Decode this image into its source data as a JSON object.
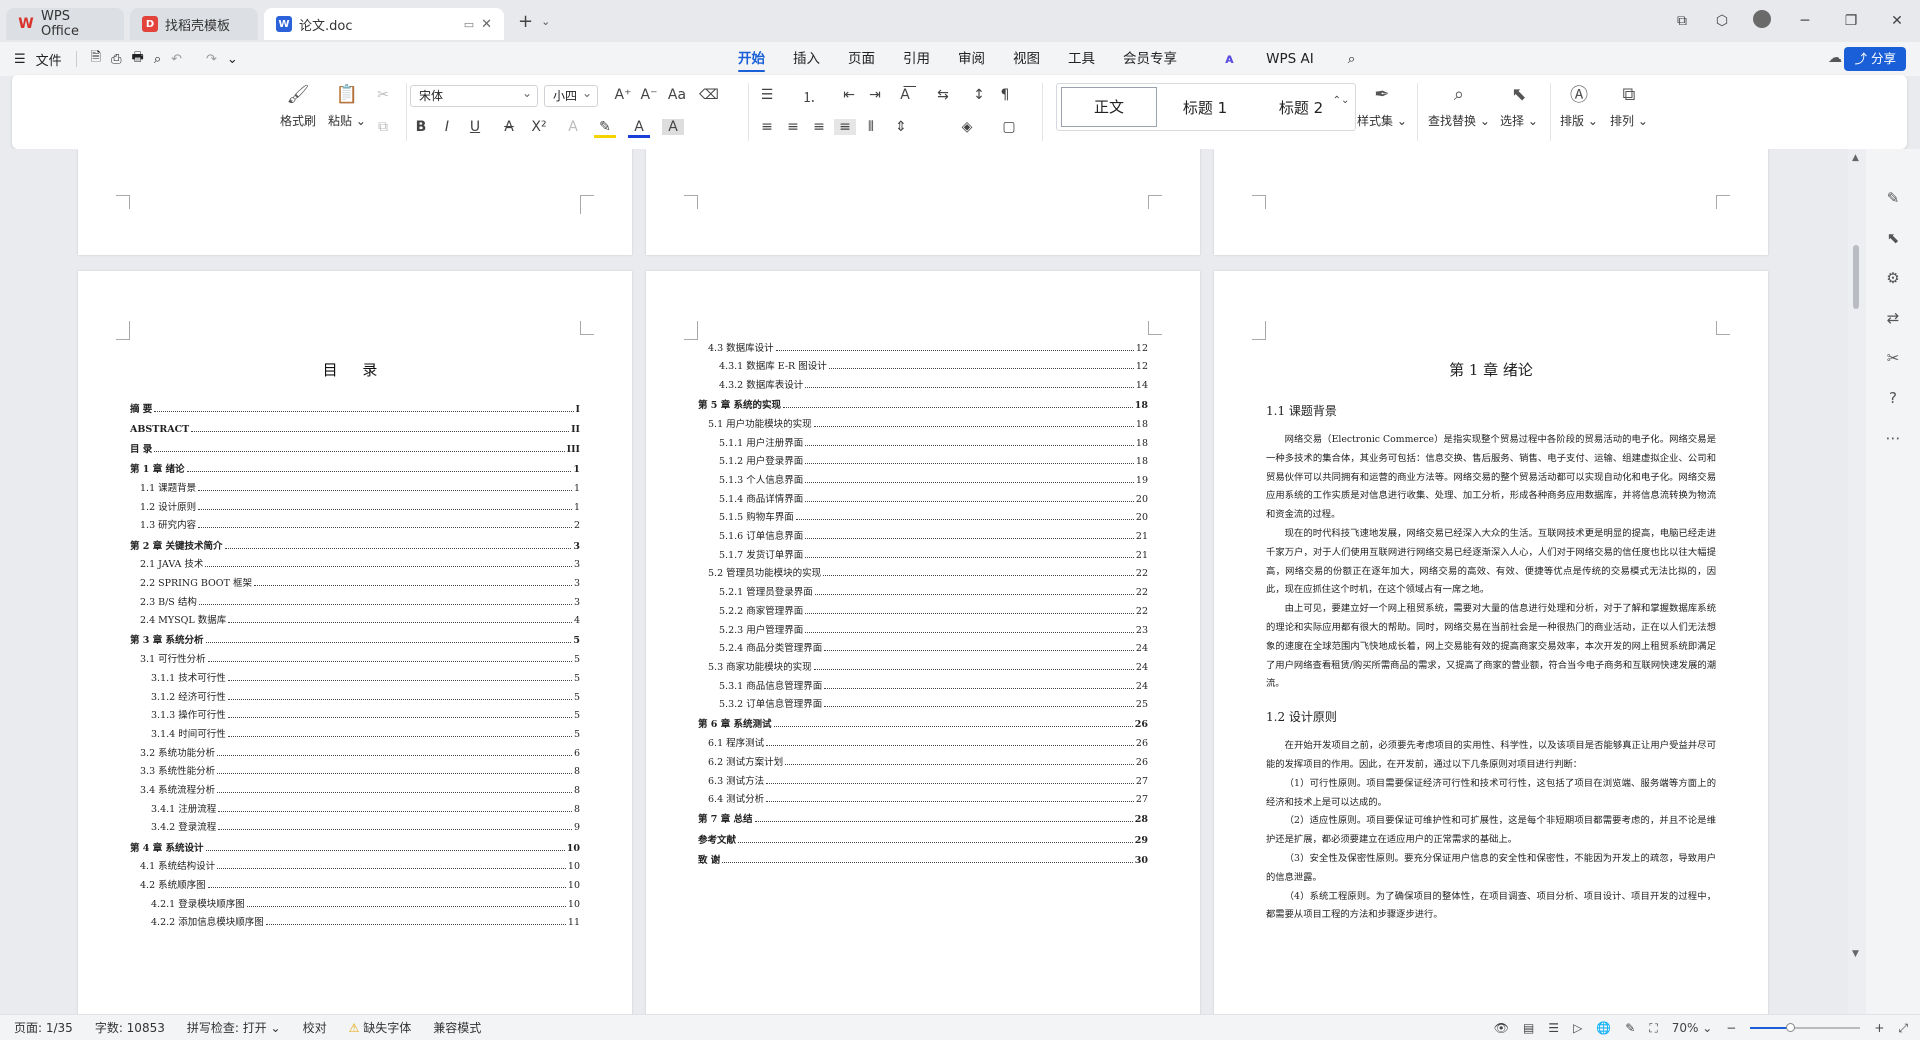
{
  "tabs": [
    {
      "label": "WPS Office",
      "icon": "wps-logo-icon"
    },
    {
      "label": "找稻壳模板",
      "icon": "docer-icon"
    },
    {
      "label": "论文.doc",
      "icon": "word-doc-icon"
    }
  ],
  "menu": {
    "file": "文件",
    "tabs": [
      "开始",
      "插入",
      "页面",
      "引用",
      "审阅",
      "视图",
      "工具",
      "会员专享"
    ],
    "active_tab": "开始",
    "wps_ai": "WPS AI",
    "share": "分享"
  },
  "ribbon": {
    "format_painter": "格式刷",
    "paste": "粘贴",
    "font_name": "宋体",
    "font_size": "小四",
    "styles": [
      "正文",
      "标题 1",
      "标题 2"
    ],
    "style_set": "样式集",
    "find_replace": "查找替换",
    "select": "选择",
    "layout": "排版",
    "arrange": "排列"
  },
  "toc": {
    "title": "目 录",
    "entries": [
      {
        "text": "摘 要",
        "page": "I",
        "level": 0
      },
      {
        "text": "ABSTRACT",
        "page": "II",
        "level": 0
      },
      {
        "text": "目 录",
        "page": "III",
        "level": 0
      },
      {
        "text": "第 1 章 绪论",
        "page": "1",
        "level": 0
      },
      {
        "text": "1.1 课题背景",
        "page": "1",
        "level": 1
      },
      {
        "text": "1.2 设计原则",
        "page": "1",
        "level": 1
      },
      {
        "text": "1.3 研究内容",
        "page": "2",
        "level": 1
      },
      {
        "text": "第 2 章 关键技术简介",
        "page": "3",
        "level": 0
      },
      {
        "text": "2.1 JAVA 技术",
        "page": "3",
        "level": 1
      },
      {
        "text": "2.2 SPRING BOOT 框架",
        "page": "3",
        "level": 1
      },
      {
        "text": "2.3 B/S 结构",
        "page": "3",
        "level": 1
      },
      {
        "text": "2.4 MYSQL 数据库",
        "page": "4",
        "level": 1
      },
      {
        "text": "第 3 章 系统分析",
        "page": "5",
        "level": 0
      },
      {
        "text": "3.1 可行性分析",
        "page": "5",
        "level": 1
      },
      {
        "text": "3.1.1 技术可行性",
        "page": "5",
        "level": 2
      },
      {
        "text": "3.1.2 经济可行性",
        "page": "5",
        "level": 2
      },
      {
        "text": "3.1.3 操作可行性",
        "page": "5",
        "level": 2
      },
      {
        "text": "3.1.4 时间可行性",
        "page": "5",
        "level": 2
      },
      {
        "text": "3.2 系统功能分析",
        "page": "6",
        "level": 1
      },
      {
        "text": "3.3 系统性能分析",
        "page": "8",
        "level": 1
      },
      {
        "text": "3.4 系统流程分析",
        "page": "8",
        "level": 1
      },
      {
        "text": "3.4.1 注册流程",
        "page": "8",
        "level": 2
      },
      {
        "text": "3.4.2 登录流程",
        "page": "9",
        "level": 2
      },
      {
        "text": "第 4 章 系统设计",
        "page": "10",
        "level": 0
      },
      {
        "text": "4.1 系统结构设计",
        "page": "10",
        "level": 1
      },
      {
        "text": "4.2 系统顺序图",
        "page": "10",
        "level": 1
      },
      {
        "text": "4.2.1 登录模块顺序图",
        "page": "10",
        "level": 2
      },
      {
        "text": "4.2.2 添加信息模块顺序图",
        "page": "11",
        "level": 2
      }
    ],
    "entries_continued": [
      {
        "text": "4.3 数据库设计",
        "page": "12",
        "level": 1
      },
      {
        "text": "4.3.1 数据库 E-R 图设计",
        "page": "12",
        "level": 2
      },
      {
        "text": "4.3.2 数据库表设计",
        "page": "14",
        "level": 2
      },
      {
        "text": "第 5 章 系统的实现",
        "page": "18",
        "level": 0
      },
      {
        "text": "5.1 用户功能模块的实现",
        "page": "18",
        "level": 1
      },
      {
        "text": "5.1.1 用户注册界面",
        "page": "18",
        "level": 2
      },
      {
        "text": "5.1.2 用户登录界面",
        "page": "18",
        "level": 2
      },
      {
        "text": "5.1.3 个人信息界面",
        "page": "19",
        "level": 2
      },
      {
        "text": "5.1.4 商品详情界面",
        "page": "20",
        "level": 2
      },
      {
        "text": "5.1.5 购物车界面",
        "page": "20",
        "level": 2
      },
      {
        "text": "5.1.6 订单信息界面",
        "page": "21",
        "level": 2
      },
      {
        "text": "5.1.7 发货订单界面",
        "page": "21",
        "level": 2
      },
      {
        "text": "5.2 管理员功能模块的实现",
        "page": "22",
        "level": 1
      },
      {
        "text": "5.2.1 管理员登录界面",
        "page": "22",
        "level": 2
      },
      {
        "text": "5.2.2 商家管理界面",
        "page": "22",
        "level": 2
      },
      {
        "text": "5.2.3 用户管理界面",
        "page": "23",
        "level": 2
      },
      {
        "text": "5.2.4 商品分类管理界面",
        "page": "24",
        "level": 2
      },
      {
        "text": "5.3 商家功能模块的实现",
        "page": "24",
        "level": 1
      },
      {
        "text": "5.3.1 商品信息管理界面",
        "page": "24",
        "level": 2
      },
      {
        "text": "5.3.2 订单信息管理界面",
        "page": "25",
        "level": 2
      },
      {
        "text": "第 6 章 系统测试",
        "page": "26",
        "level": 0
      },
      {
        "text": "6.1 程序测试",
        "page": "26",
        "level": 1
      },
      {
        "text": "6.2 测试方案计划",
        "page": "26",
        "level": 1
      },
      {
        "text": "6.3 测试方法",
        "page": "27",
        "level": 1
      },
      {
        "text": "6.4 测试分析",
        "page": "27",
        "level": 1
      },
      {
        "text": "第 7 章 总结",
        "page": "28",
        "level": 0
      },
      {
        "text": "参考文献",
        "page": "29",
        "level": 0
      },
      {
        "text": "致 谢",
        "page": "30",
        "level": 0
      }
    ]
  },
  "chapter": {
    "title": "第 1 章 绪论",
    "h_background": "1.1 课题背景",
    "p1": "网络交易（Electronic Commerce）是指实现整个贸易过程中各阶段的贸易活动的电子化。网络交易是一种多技术的集合体，其业务可包括：信息交换、售后服务、销售、电子支付、运输、组建虚拟企业、公司和贸易伙伴可以共同拥有和运营的商业方法等。网络交易的整个贸易活动都可以实现自动化和电子化。网络交易应用系统的工作实质是对信息进行收集、处理、加工分析，形成各种商务应用数据库，并将信息流转换为物流和资金流的过程。",
    "p2": "现在的时代科技飞速地发展，网络交易已经深入大众的生活。互联网技术更是明显的提高，电脑已经走进千家万户，对于人们使用互联网进行网络交易已经逐渐深入人心，人们对于网络交易的信任度也比以往大幅提高，网络交易的份额正在逐年加大，网络交易的高效、有效、便捷等优点是传统的交易模式无法比拟的，因此，现在应抓住这个时机，在这个领域占有一席之地。",
    "p3": "由上可见，要建立好一个网上租贸系统，需要对大量的信息进行处理和分析，对于了解和掌握数据库系统的理论和实际应用都有很大的帮助。同时，网络交易在当前社会是一种很热门的商业活动，正在以人们无法想象的速度在全球范围内飞快地成长着，网上交易能有效的提高商家交易效率，本次开发的网上租贸系统即满足了用户网络查看租赁/购买所需商品的需求，又提高了商家的营业额，符合当今电子商务和互联网快速发展的潮流。",
    "h_principle": "1.2 设计原则",
    "p4": "在开始开发项目之前，必须要先考虑项目的实用性、科学性，以及该项目是否能够真正让用户受益并尽可能的发挥项目的作用。因此，在开发前，通过以下几条原则对项目进行判断：",
    "p5": "（1）可行性原则。项目需要保证经济可行性和技术可行性，这包括了项目在浏览端、服务端等方面上的经济和技术上是可以达成的。",
    "p6": "（2）适应性原则。项目要保证可维护性和可扩展性，这是每个非短期项目都需要考虑的，并且不论是维护还是扩展，都必须要建立在适应用户的正常需求的基础上。",
    "p7": "（3）安全性及保密性原则。要充分保证用户信息的安全性和保密性，不能因为开发上的疏忽，导致用户的信息泄露。",
    "p8": "（4）系统工程原则。为了确保项目的整体性，在项目调查、项目分析、项目设计、项目开发的过程中，都需要从项目工程的方法和步骤逐步进行。"
  },
  "status": {
    "page": "页面: 1/35",
    "words": "字数: 10853",
    "spell": "拼写检查: 打开",
    "proof": "校对",
    "missing_font": "缺失字体",
    "compat": "兼容模式",
    "zoom": "70%"
  }
}
